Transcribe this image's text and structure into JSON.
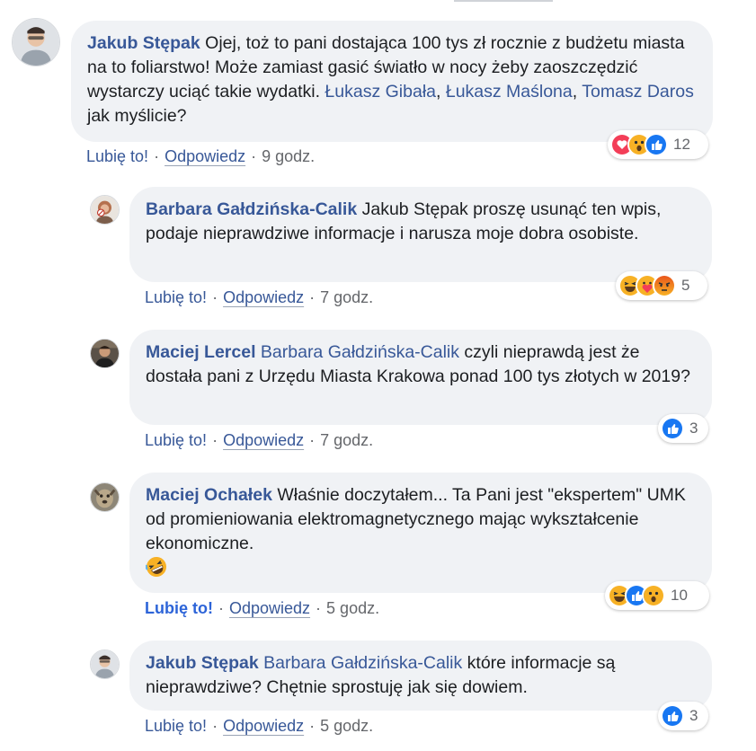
{
  "comments": [
    {
      "author": "Jakub Stępak",
      "text_before": " Ojej, toż to pani dostająca 100 tys zł rocznie z budżetu miasta na to foliarstwo! Może zamiast gasić światło w nocy żeby zaoszczędzić wystarczy uciąć takie wydatki. ",
      "tags": [
        "Łukasz Gibała",
        ", ",
        "Łukasz Maślona",
        ", ",
        "Tomasz Daros"
      ],
      "text_after": " jak myślicie?",
      "like": "Lubię to!",
      "reply": "Odpowiedz",
      "time": "9 godz.",
      "reaction_count": "12",
      "reactions": [
        "love-icon",
        "wow-icon",
        "like-icon"
      ]
    },
    {
      "author": "Barbara Gałdzińska-Calik",
      "text_before": " Jakub Stępak proszę usunąć ten wpis, podaje nieprawdziwe informacje i narusza moje dobra osobiste.",
      "like": "Lubię to!",
      "reply": "Odpowiedz",
      "time": "7 godz.",
      "reaction_count": "5",
      "reactions": [
        "haha-icon",
        "care-icon",
        "angry-icon"
      ]
    },
    {
      "author": "Maciej Lercel",
      "tag": "Barbara Gałdzińska-Calik",
      "text_after": " czyli nieprawdą jest że dostała pani z Urzędu Miasta Krakowa ponad 100 tys złotych w 2019?",
      "like": "Lubię to!",
      "reply": "Odpowiedz",
      "time": "7 godz.",
      "reaction_count": "3",
      "reactions": [
        "like-icon"
      ]
    },
    {
      "author": "Maciej Ochałek",
      "text_before": " Właśnie doczytałem... Ta Pani jest \"ekspertem\" UMK od promieniowania elektromagnetycznego mając wykształcenie ekonomiczne.",
      "emoji": "rolling-laughing-emoji",
      "like": "Lubię to!",
      "reply": "Odpowiedz",
      "time": "5 godz.",
      "reaction_count": "10",
      "reactions": [
        "haha-icon",
        "like-icon",
        "wow-icon"
      ]
    },
    {
      "author": "Jakub Stępak",
      "tag": "Barbara Gałdzińska-Calik",
      "text_after": " które informacje są nieprawdziwe? Chętnie sprostuję jak się dowiem.",
      "like": "Lubię to!",
      "reply": "Odpowiedz",
      "time": "5 godz.",
      "reaction_count": "3",
      "reactions": [
        "like-icon"
      ]
    }
  ],
  "separator": "·",
  "colors": {
    "link": "#385898",
    "bubble": "#f0f2f5",
    "meta": "#65676b",
    "like_blue": "#1877f2",
    "love_red": "#f33e58",
    "emoji_yellow": "#f7b125"
  }
}
